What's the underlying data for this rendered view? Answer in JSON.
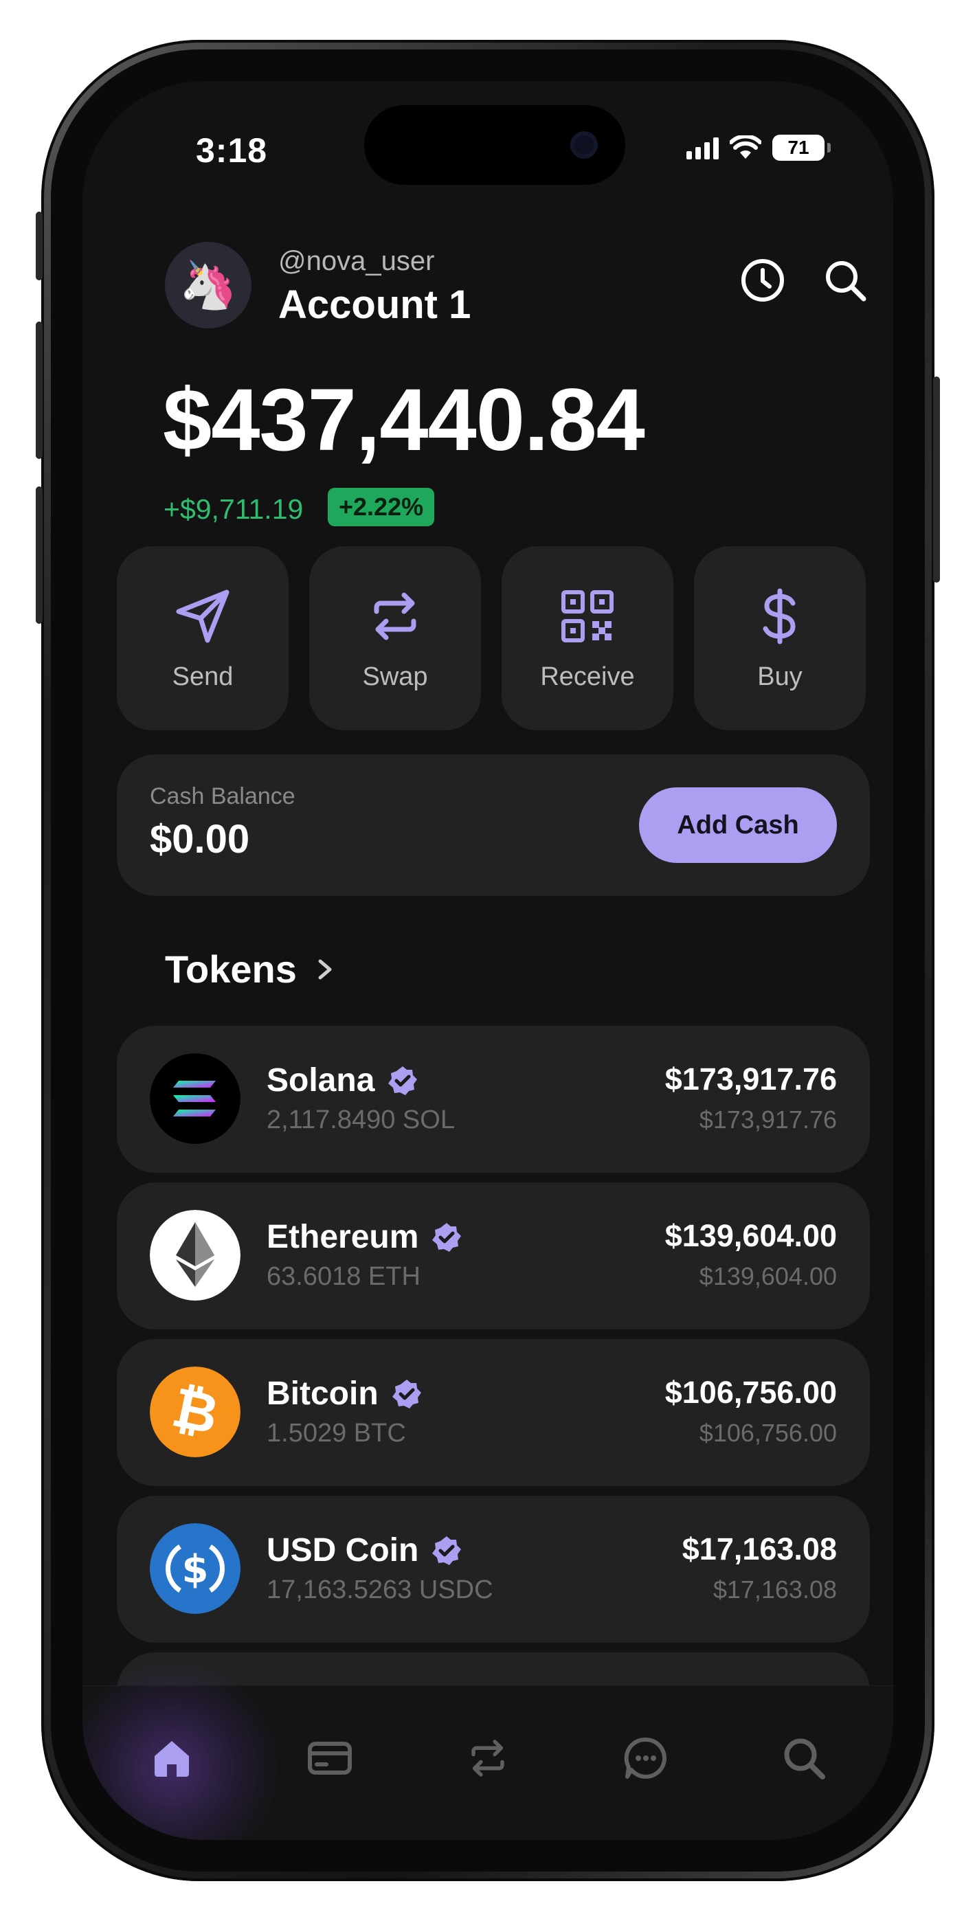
{
  "status_bar": {
    "time": "3:18",
    "battery": "71"
  },
  "header": {
    "avatar": "🦄",
    "handle": "@nova_user",
    "account": "Account 1",
    "history_icon": "clock-icon",
    "search_icon": "search-icon"
  },
  "balance": {
    "total": "$437,440.84",
    "change": "+$9,711.19",
    "percent": "+2.22%"
  },
  "actions": [
    {
      "label": "Send",
      "icon": "send-icon"
    },
    {
      "label": "Swap",
      "icon": "swap-icon"
    },
    {
      "label": "Receive",
      "icon": "qr-code-icon"
    },
    {
      "label": "Buy",
      "icon": "dollar-icon"
    }
  ],
  "cash": {
    "title": "Cash Balance",
    "value": "$0.00",
    "button": "Add Cash"
  },
  "tokens": {
    "title": "Tokens",
    "items": [
      {
        "name": "Solana",
        "amount": "2,117.8490 SOL",
        "value": "$173,917.76",
        "sub": "$173,917.76"
      },
      {
        "name": "Ethereum",
        "amount": "63.6018 ETH",
        "value": "$139,604.00",
        "sub": "$139,604.00"
      },
      {
        "name": "Bitcoin",
        "amount": "1.5029 BTC",
        "value": "$106,756.00",
        "sub": "$106,756.00"
      },
      {
        "name": "USD Coin",
        "amount": "17,163.5263 USDC",
        "value": "$17,163.08",
        "sub": "$17,163.08"
      }
    ]
  },
  "tab_bar": [
    "home-icon",
    "card-icon",
    "swap-icon",
    "chat-icon",
    "search-icon"
  ],
  "colors": {
    "accent": "#ab9ff2",
    "positive": "#2fbe6f",
    "background": "#121212",
    "card": "#222222"
  }
}
